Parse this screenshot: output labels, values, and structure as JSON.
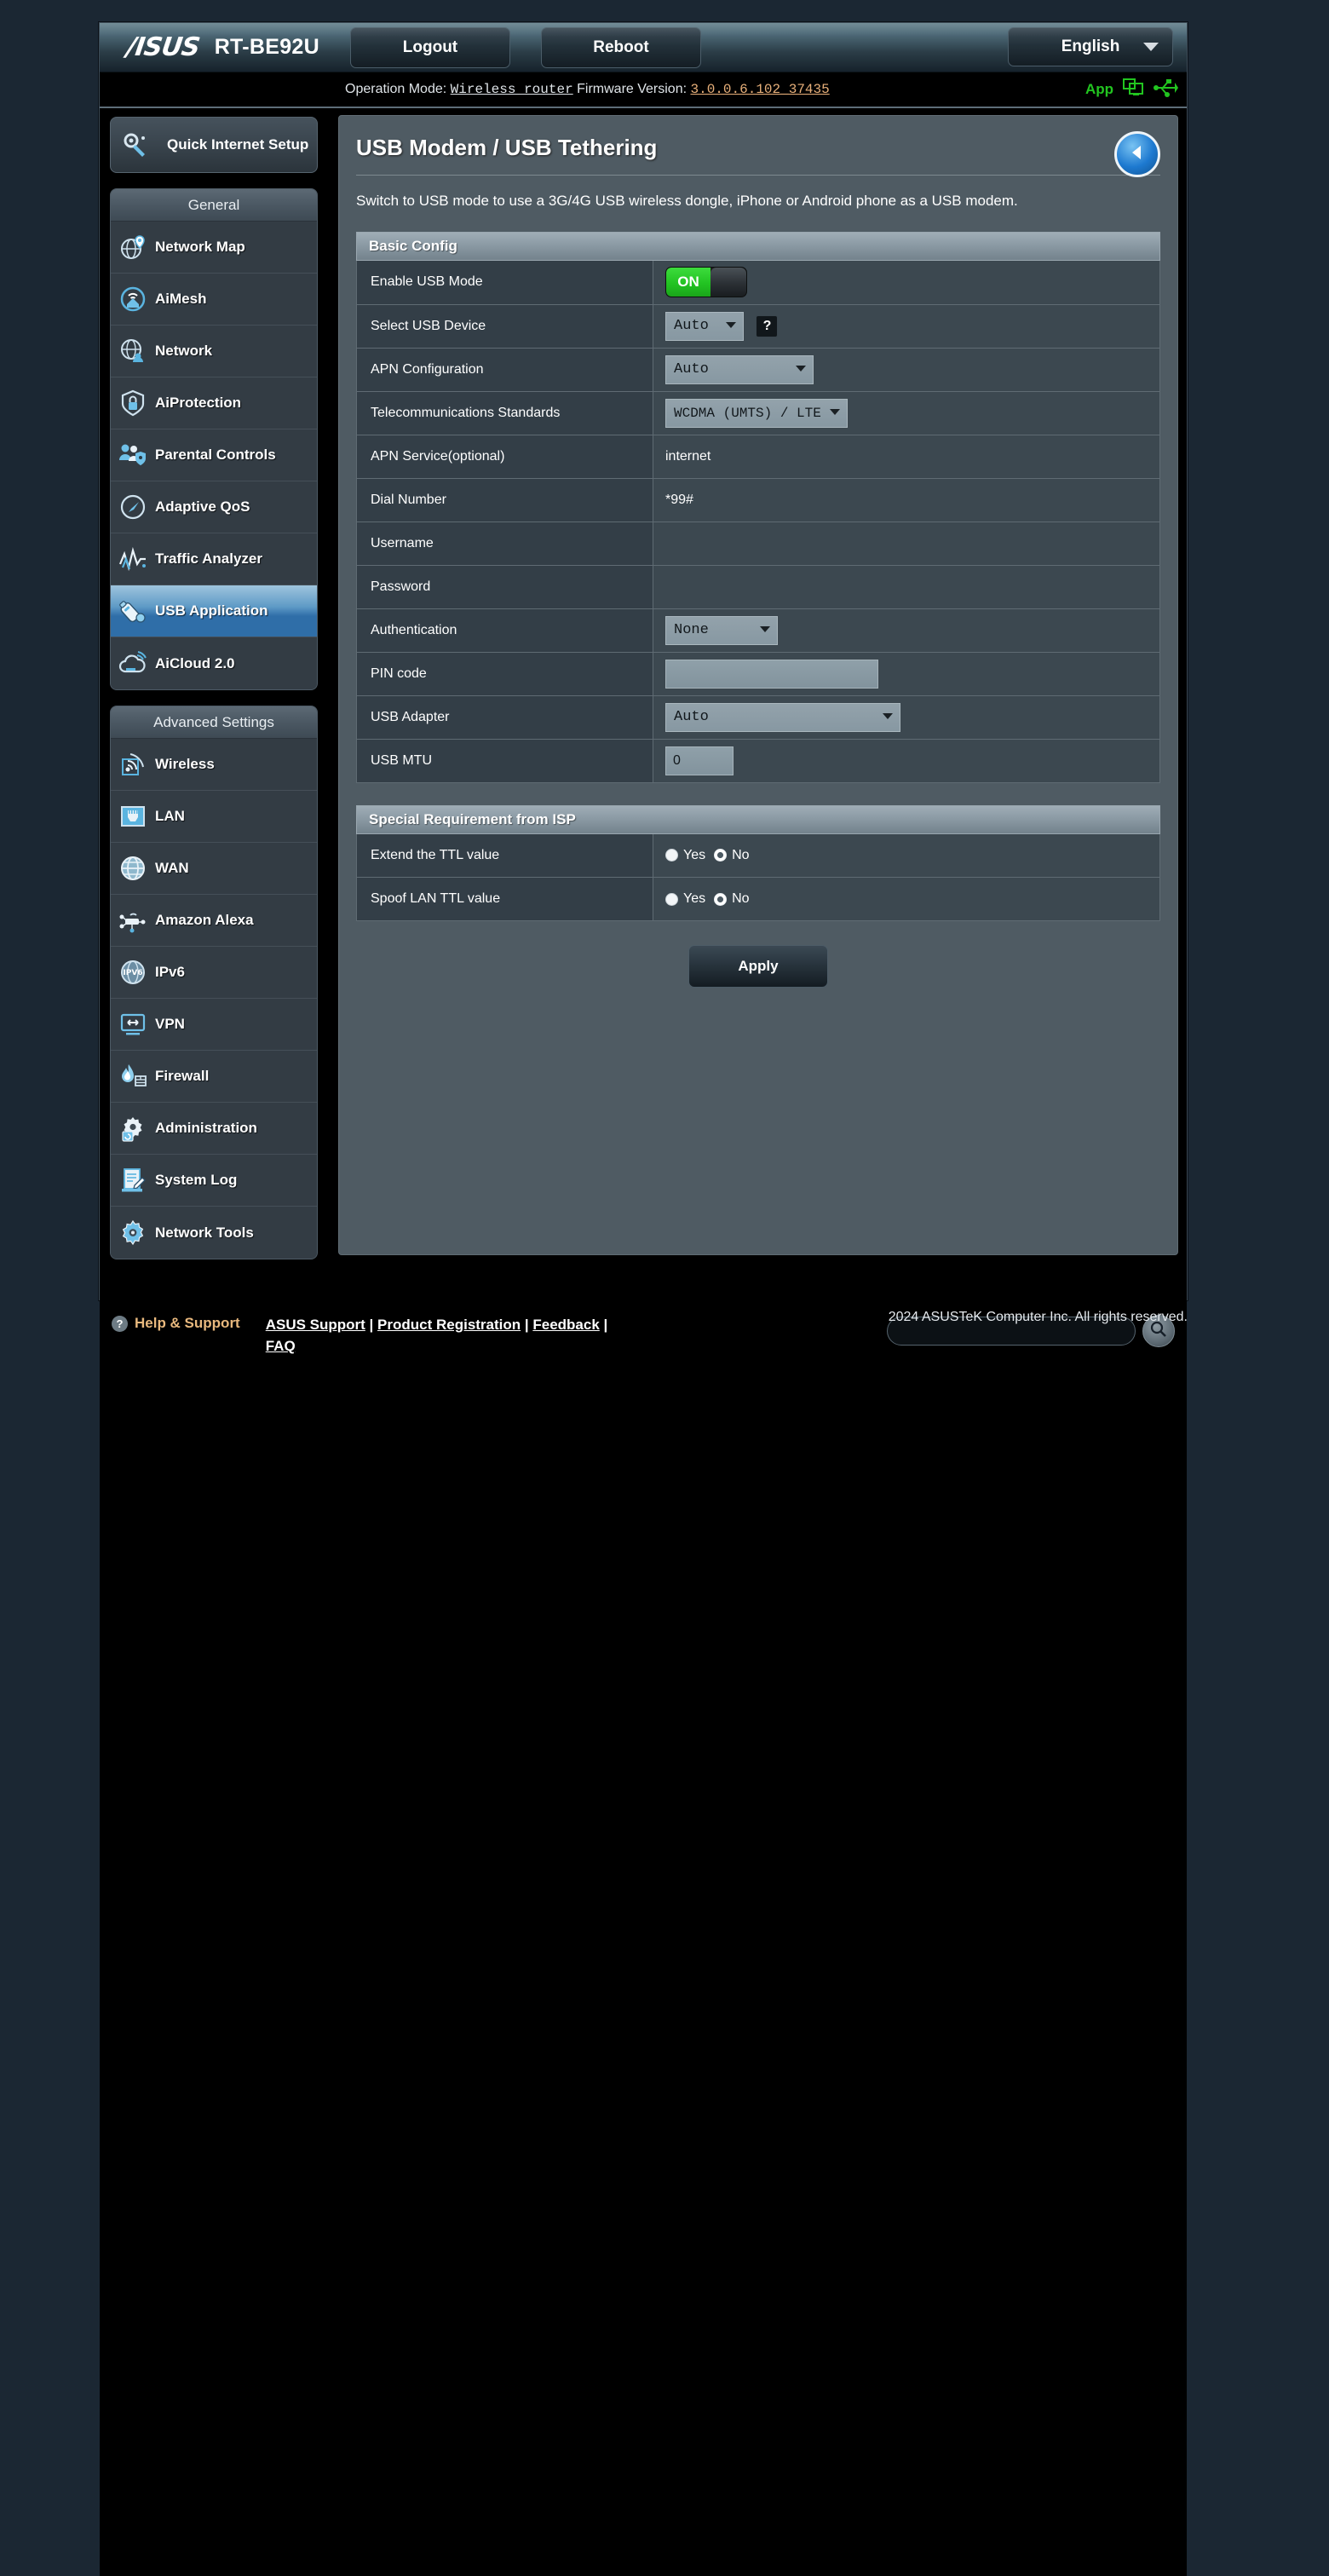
{
  "header": {
    "brand": "/ISUS",
    "model": "RT-BE92U",
    "logout_label": "Logout",
    "reboot_label": "Reboot",
    "language": "English",
    "app_label": "App"
  },
  "statusbar": {
    "operation_mode_label": "Operation Mode:",
    "operation_mode_value": "Wireless router",
    "firmware_label": "Firmware Version:",
    "firmware_value": "3.0.0.6.102_37435"
  },
  "sidebar": {
    "quick_setup": "Quick Internet Setup",
    "general_title": "General",
    "general_items": [
      {
        "label": "Network Map",
        "icon": "network-map-icon"
      },
      {
        "label": "AiMesh",
        "icon": "aimesh-icon"
      },
      {
        "label": "Network",
        "icon": "network-icon"
      },
      {
        "label": "AiProtection",
        "icon": "shield-lock-icon"
      },
      {
        "label": "Parental Controls",
        "icon": "parental-controls-icon"
      },
      {
        "label": "Adaptive QoS",
        "icon": "gauge-icon"
      },
      {
        "label": "Traffic Analyzer",
        "icon": "traffic-analyzer-icon"
      },
      {
        "label": "USB Application",
        "icon": "usb-drive-icon"
      },
      {
        "label": "AiCloud 2.0",
        "icon": "cloud-icon"
      }
    ],
    "advanced_title": "Advanced Settings",
    "advanced_items": [
      {
        "label": "Wireless",
        "icon": "wireless-icon"
      },
      {
        "label": "LAN",
        "icon": "lan-port-icon"
      },
      {
        "label": "WAN",
        "icon": "globe-icon"
      },
      {
        "label": "Amazon Alexa",
        "icon": "alexa-icon"
      },
      {
        "label": "IPv6",
        "icon": "ipv6-icon"
      },
      {
        "label": "VPN",
        "icon": "vpn-icon"
      },
      {
        "label": "Firewall",
        "icon": "firewall-flame-icon"
      },
      {
        "label": "Administration",
        "icon": "gear-admin-icon"
      },
      {
        "label": "System Log",
        "icon": "system-log-icon"
      },
      {
        "label": "Network Tools",
        "icon": "network-tools-icon"
      }
    ],
    "active_item": "USB Application"
  },
  "page": {
    "title": "USB Modem / USB Tethering",
    "description": "Switch to USB mode to use a 3G/4G USB wireless dongle, iPhone or Android phone as a USB modem.",
    "basic_config_title": "Basic Config",
    "special_title": "Special Requirement from ISP",
    "apply_label": "Apply"
  },
  "form": {
    "enable_usb_mode": {
      "label": "Enable USB Mode",
      "state": "ON"
    },
    "select_usb_device": {
      "label": "Select USB Device",
      "value": "Auto",
      "help": "?"
    },
    "apn_configuration": {
      "label": "APN Configuration",
      "value": "Auto"
    },
    "telecom_standards": {
      "label": "Telecommunications Standards",
      "value": "WCDMA (UMTS) / LTE"
    },
    "apn_service": {
      "label": "APN Service(optional)",
      "value": "internet"
    },
    "dial_number": {
      "label": "Dial Number",
      "value": "*99#"
    },
    "username": {
      "label": "Username",
      "value": ""
    },
    "password": {
      "label": "Password",
      "value": ""
    },
    "authentication": {
      "label": "Authentication",
      "value": "None"
    },
    "pin_code": {
      "label": "PIN code",
      "value": ""
    },
    "usb_adapter": {
      "label": "USB Adapter",
      "value": "Auto"
    },
    "usb_mtu": {
      "label": "USB MTU",
      "value": "0"
    }
  },
  "isp": {
    "extend_ttl": {
      "label": "Extend the TTL value",
      "yes": "Yes",
      "no": "No",
      "selected": "No"
    },
    "spoof_lan_ttl": {
      "label": "Spoof LAN TTL value",
      "yes": "Yes",
      "no": "No",
      "selected": "No"
    }
  },
  "footer": {
    "help_support": "Help & Support",
    "links": [
      "ASUS Support",
      "Product Registration",
      "Feedback",
      "FAQ"
    ],
    "search_placeholder": "",
    "copyright": "2024 ASUSTeK Computer Inc. All rights reserved."
  },
  "colors": {
    "accent_blue": "#2f6ea8",
    "toggle_on_green": "#22c322",
    "firmware_orange": "#e8b07a",
    "help_orange": "#e9b97e"
  }
}
